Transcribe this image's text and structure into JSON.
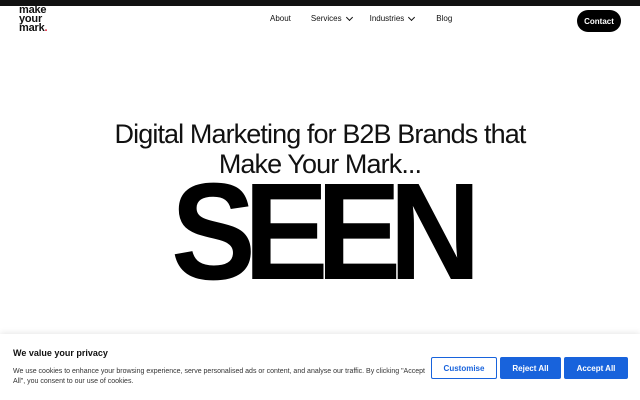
{
  "logo": {
    "line1": "make",
    "line2": "your",
    "line3": "mark",
    "dot": "."
  },
  "nav": {
    "items": [
      {
        "label": "About"
      },
      {
        "label": "Services"
      },
      {
        "label": "Industries"
      },
      {
        "label": "Blog"
      }
    ],
    "contact_label": "Contact"
  },
  "hero": {
    "title_line1": "Digital Marketing for B2B Brands that",
    "title_line2": "Make Your Mark...",
    "word": "SEEN"
  },
  "cookie": {
    "title": "We value your privacy",
    "text": "We use cookies to enhance your browsing experience, serve personalised ads or content, and analyse our traffic. By clicking \"Accept All\", you consent to our use of cookies.",
    "customise_label": "Customise",
    "reject_label": "Reject All",
    "accept_label": "Accept All"
  },
  "colors": {
    "accent": "#1863dc",
    "brand_dot": "#e0213a",
    "text": "#111111"
  }
}
